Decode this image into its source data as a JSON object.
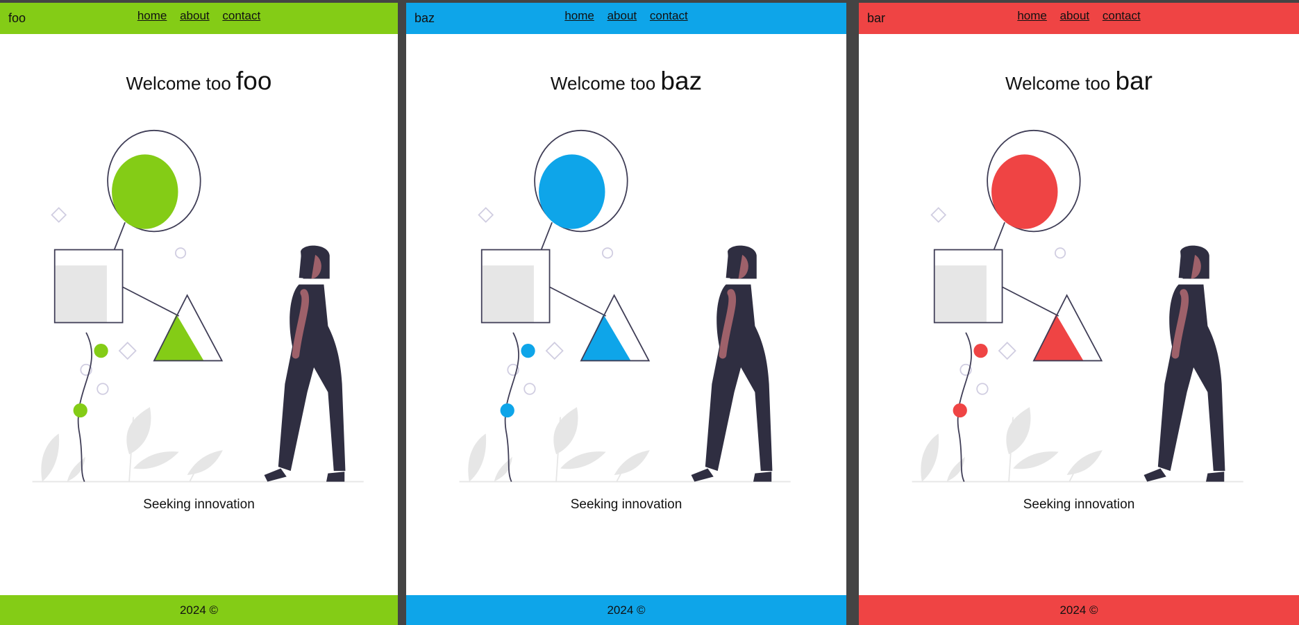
{
  "nav": {
    "home": "home",
    "about": "about",
    "contact": "contact"
  },
  "panels": [
    {
      "brand": "foo",
      "welcome": "Welcome too",
      "name": "foo",
      "tagline": "Seeking innovation",
      "footer": "2024 ©",
      "accent": "#84cc16"
    },
    {
      "brand": "baz",
      "welcome": "Welcome too",
      "name": "baz",
      "tagline": "Seeking innovation",
      "footer": "2024 ©",
      "accent": "#0ea5e9"
    },
    {
      "brand": "bar",
      "welcome": "Welcome too",
      "name": "bar",
      "tagline": "Seeking innovation",
      "footer": "2024 ©",
      "accent": "#ef4444"
    }
  ]
}
